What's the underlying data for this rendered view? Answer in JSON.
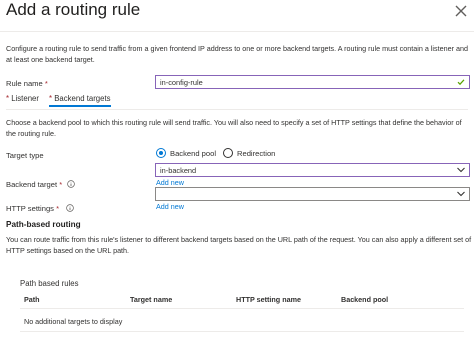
{
  "header": {
    "title": "Add a routing rule"
  },
  "description": "Configure a routing rule to send traffic from a given frontend IP address to one or more backend targets. A routing rule must contain a listener and at least one backend target.",
  "rule_name": {
    "label": "Rule name",
    "required_mark": "*",
    "value": "in-config-rule"
  },
  "tabs": [
    {
      "label": "Listener",
      "required_mark": "*",
      "selected": false
    },
    {
      "label": "Backend targets",
      "required_mark": "*",
      "selected": true
    }
  ],
  "backend_description": "Choose a backend pool to which this routing rule will send traffic. You will also need to specify a set of HTTP settings that define the behavior of the routing rule.",
  "target_type": {
    "label": "Target type",
    "options": [
      {
        "label": "Backend pool",
        "selected": true
      },
      {
        "label": "Redirection",
        "selected": false
      }
    ]
  },
  "backend_pool_dropdown": {
    "value": "in-backend"
  },
  "backend_target": {
    "label": "Backend target",
    "required_mark": "*",
    "add_new_link": "Add new",
    "value": ""
  },
  "http_settings": {
    "label": "HTTP settings",
    "required_mark": "*",
    "add_new_link": "Add new"
  },
  "path_based_routing": {
    "title": "Path-based routing",
    "description": "You can route traffic from this rule's listener to different backend targets based on the URL path of the request. You can also apply a different set of HTTP settings based on the URL path."
  },
  "path_rules": {
    "title": "Path based rules",
    "columns": [
      "Path",
      "Target name",
      "HTTP setting name",
      "Backend pool"
    ],
    "empty_text": "No additional targets to display"
  },
  "colors": {
    "accent": "#0078d4",
    "focus_border": "#8764b8",
    "required": "#a4262c",
    "valid": "#57a300"
  }
}
